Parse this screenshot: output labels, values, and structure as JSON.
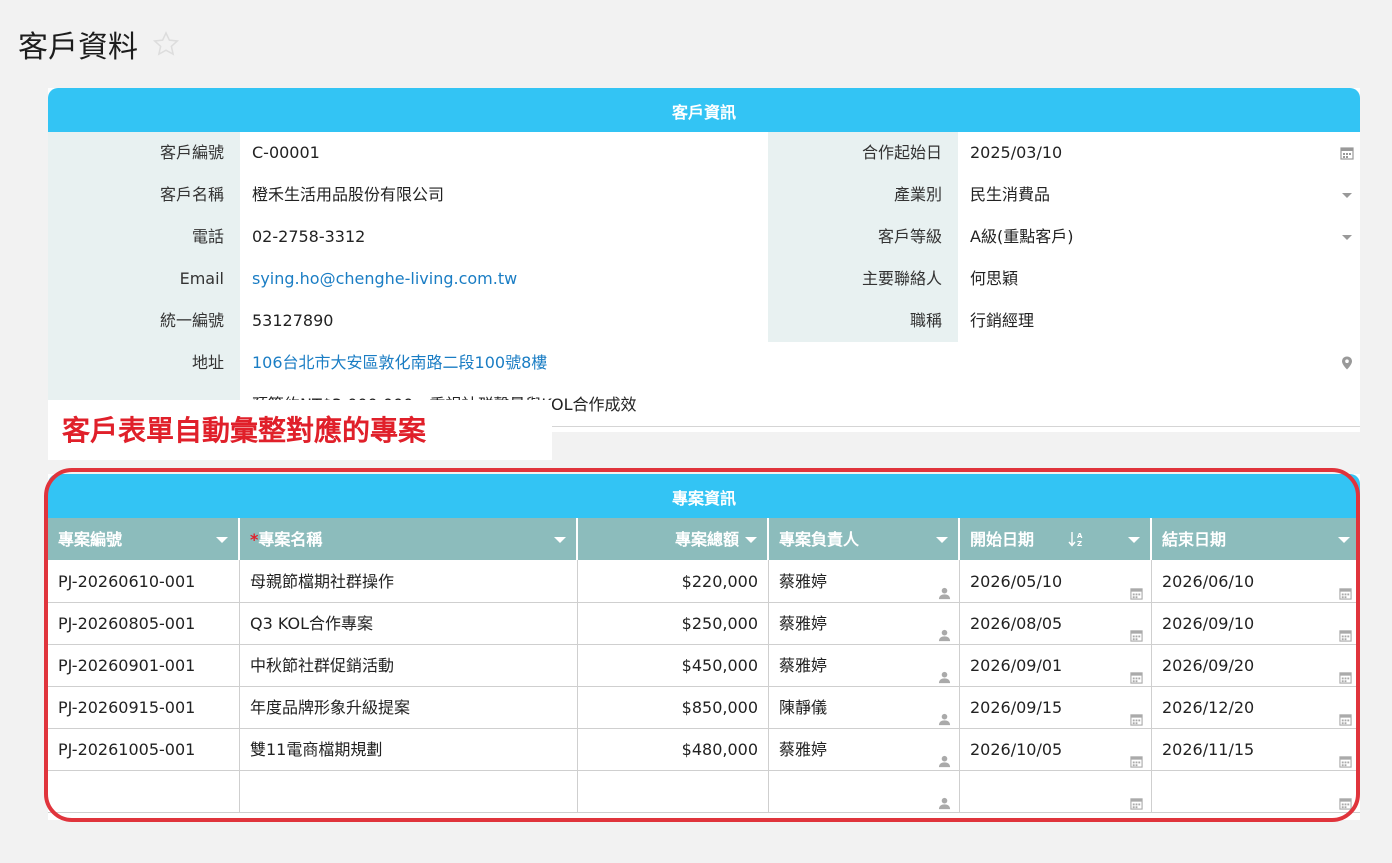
{
  "page": {
    "title": "客戶資料"
  },
  "info": {
    "header": "客戶資訊",
    "fields": {
      "customer_id_label": "客戶編號",
      "customer_id": "C-00001",
      "start_date_label": "合作起始日",
      "start_date": "2025/03/10",
      "name_label": "客戶名稱",
      "name": "橙禾生活用品股份有限公司",
      "industry_label": "產業別",
      "industry": "民生消費品",
      "phone_label": "電話",
      "phone": "02-2758-3312",
      "level_label": "客戶等級",
      "level": "A級(重點客戶)",
      "email_label": "Email",
      "email": "sying.ho@chenghe-living.com.tw",
      "contact_label": "主要聯絡人",
      "contact": "何思穎",
      "tax_id_label": "統一編號",
      "tax_id": "53127890",
      "title_label": "職稱",
      "title": "行銷經理",
      "address_label": "地址",
      "address": "106台北市大安區敦化南路二段100號8樓",
      "note": "預算約NT$3,000,000，重視社群聲量與KOL合作成效"
    }
  },
  "callout": "客戶表單自動彙整對應的專案",
  "projects": {
    "header": "專案資訊",
    "columns": {
      "id": "專案編號",
      "name_req": "*",
      "name": "專案名稱",
      "amount": "專案總額",
      "owner": "專案負責人",
      "start": "開始日期",
      "end": "結束日期"
    },
    "rows": [
      {
        "id": "PJ-20260610-001",
        "name": "母親節檔期社群操作",
        "amount": "$220,000",
        "owner": "蔡雅婷",
        "start": "2026/05/10",
        "end": "2026/06/10"
      },
      {
        "id": "PJ-20260805-001",
        "name": "Q3 KOL合作專案",
        "amount": "$250,000",
        "owner": "蔡雅婷",
        "start": "2026/08/05",
        "end": "2026/09/10"
      },
      {
        "id": "PJ-20260901-001",
        "name": "中秋節社群促銷活動",
        "amount": "$450,000",
        "owner": "蔡雅婷",
        "start": "2026/09/01",
        "end": "2026/09/20"
      },
      {
        "id": "PJ-20260915-001",
        "name": "年度品牌形象升級提案",
        "amount": "$850,000",
        "owner": "陳靜儀",
        "start": "2026/09/15",
        "end": "2026/12/20"
      },
      {
        "id": "PJ-20261005-001",
        "name": "雙11電商檔期規劃",
        "amount": "$480,000",
        "owner": "蔡雅婷",
        "start": "2026/10/05",
        "end": "2026/11/15"
      },
      {
        "id": "",
        "name": "",
        "amount": "",
        "owner": "",
        "start": "",
        "end": ""
      }
    ]
  },
  "colors": {
    "header_bg": "#33c4f4",
    "label_bg": "#e8f1f1",
    "thead_bg": "#8cbcbc",
    "highlight": "#e0343c"
  }
}
